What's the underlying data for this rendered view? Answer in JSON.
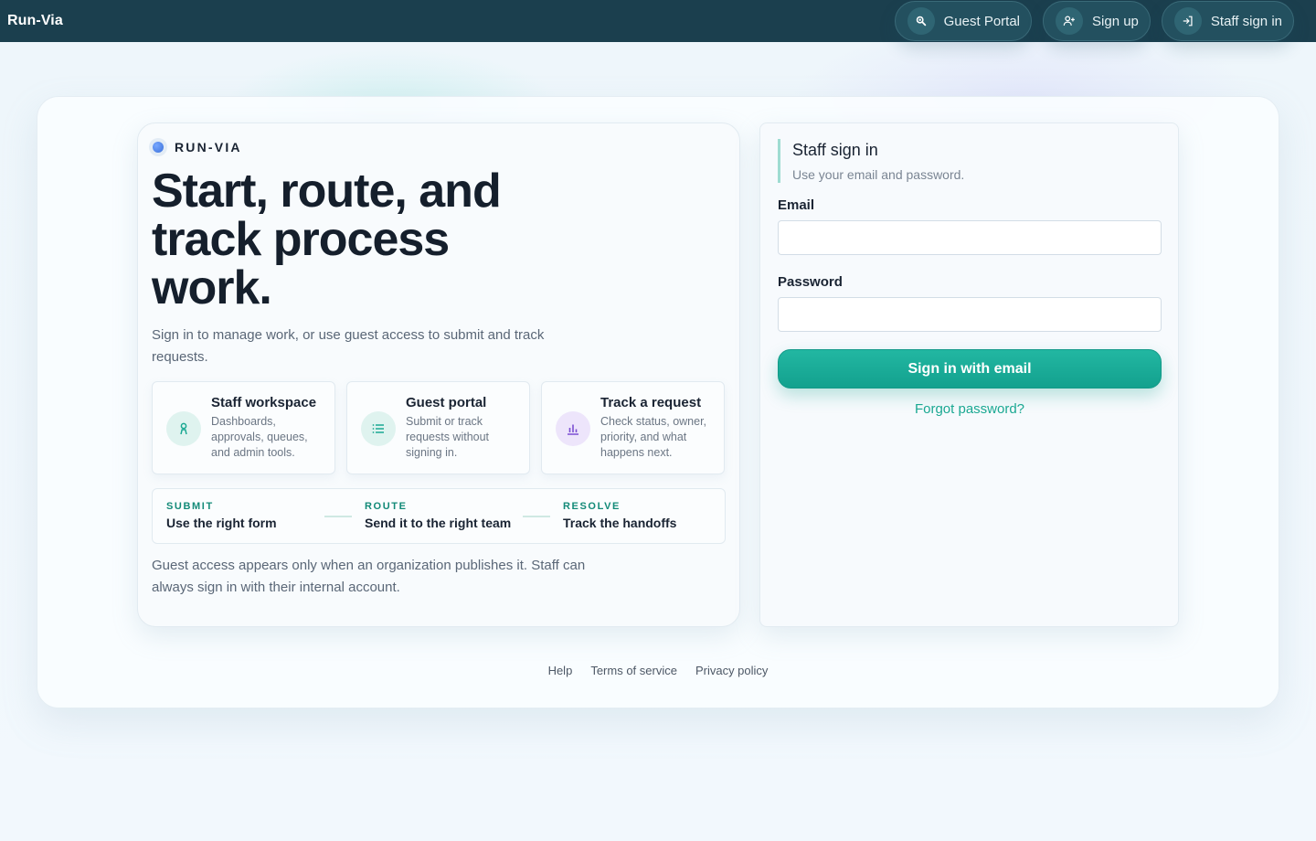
{
  "header": {
    "brand": "Run-Via",
    "nav": [
      {
        "label": "Guest Portal",
        "icon": "search-icon"
      },
      {
        "label": "Sign up",
        "icon": "user-plus-icon"
      },
      {
        "label": "Staff sign in",
        "icon": "sign-in-icon"
      }
    ]
  },
  "hero": {
    "eyebrow": "RUN-VIA",
    "headline": "Start, route, and track process work.",
    "subtext": "Sign in to manage work, or use guest access to submit and track requests.",
    "features": [
      {
        "title": "Staff workspace",
        "desc": "Dashboards, approvals, queues, and admin tools.",
        "icon": "person-icon",
        "color": "#1aa892"
      },
      {
        "title": "Guest portal",
        "desc": "Submit or track requests without signing in.",
        "icon": "list-icon",
        "color": "#1aa892"
      },
      {
        "title": "Track a request",
        "desc": "Check status, owner, priority, and what happens next.",
        "icon": "bar-chart-icon",
        "color": "#7b4fd3"
      }
    ],
    "steps": [
      {
        "key": "SUBMIT",
        "value": "Use the right form"
      },
      {
        "key": "ROUTE",
        "value": "Send it to the right team"
      },
      {
        "key": "RESOLVE",
        "value": "Track the handoffs"
      }
    ],
    "note": "Guest access appears only when an organization publishes it. Staff can always sign in with their internal account."
  },
  "signin": {
    "title": "Staff sign in",
    "subtitle": "Use your email and password.",
    "email_label": "Email",
    "email_value": "",
    "password_label": "Password",
    "password_value": "",
    "submit_label": "Sign in with email",
    "forgot_label": "Forgot password?"
  },
  "footer": {
    "links": [
      "Help",
      "Terms of service",
      "Privacy policy"
    ]
  },
  "colors": {
    "accent": "#1aa892",
    "topbar": "#1b3f4e",
    "purple": "#7b4fd3"
  }
}
